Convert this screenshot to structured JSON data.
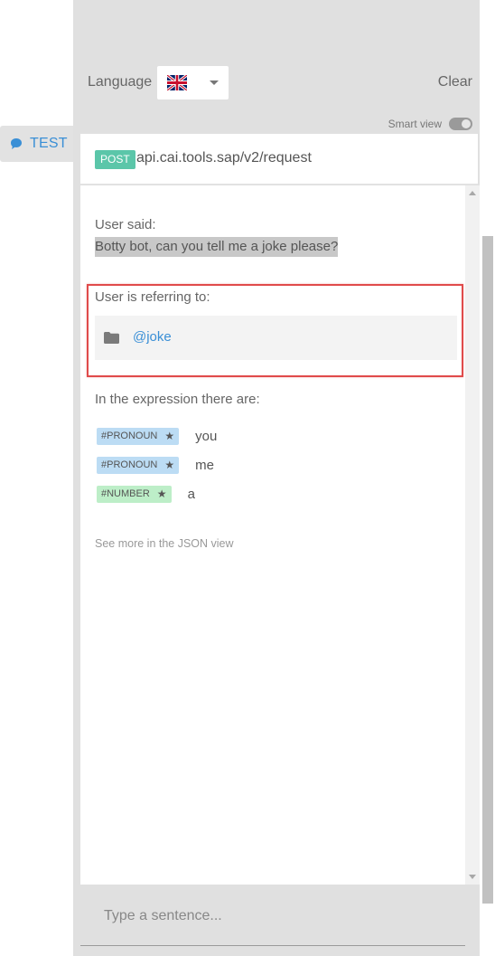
{
  "nav": {
    "test_tab_label": "TEST"
  },
  "toolbar": {
    "language_label": "Language",
    "language_selected": "UK flag",
    "clear_label": "Clear",
    "smart_view_label": "Smart view",
    "smart_view_enabled": true
  },
  "request": {
    "method": "POST",
    "url": "api.cai.tools.sap/v2/request"
  },
  "analysis": {
    "user_said_label": "User said:",
    "user_said_text": "Botty bot, can you tell me a joke please?",
    "referring_label": "User is referring to:",
    "intent": "@joke",
    "expression_label": "In the expression there are:",
    "entities": [
      {
        "tag": "#PRONOUN",
        "value": "you"
      },
      {
        "tag": "#PRONOUN",
        "value": "me"
      },
      {
        "tag": "#NUMBER",
        "value": "a"
      }
    ],
    "json_link": "See more in the JSON view"
  },
  "input": {
    "placeholder": "Type a sentence..."
  },
  "colors": {
    "accent": "#3a8fd6",
    "post_badge": "#5bc6a9",
    "pronoun_tag": "#bcdcf4",
    "number_tag": "#bdeec8",
    "highlight": "#e04b4b"
  }
}
